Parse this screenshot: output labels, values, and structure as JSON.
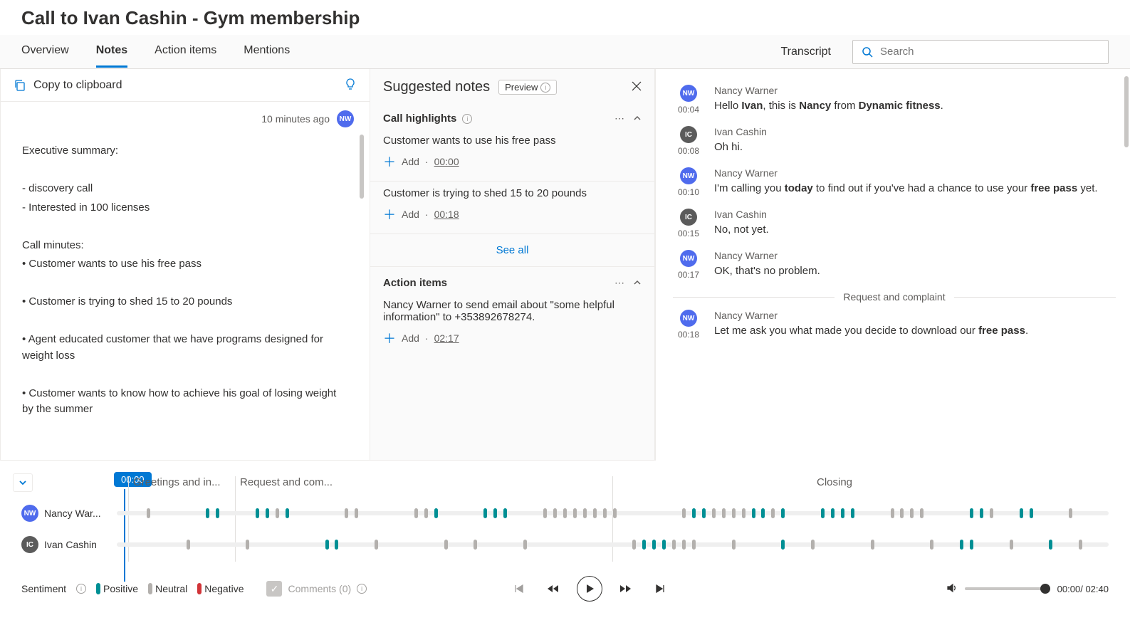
{
  "page_title": "Call to Ivan Cashin - Gym membership",
  "tabs": {
    "overview": "Overview",
    "notes": "Notes",
    "action_items": "Action items",
    "mentions": "Mentions"
  },
  "transcript_label": "Transcript",
  "search_placeholder": "Search",
  "copy_label": "Copy to clipboard",
  "notes_meta_time": "10 minutes ago",
  "notes_meta_initials": "NW",
  "notes_body": {
    "l1": "Executive summary:",
    "l2": "- discovery call",
    "l3": "- Interested in 100 licenses",
    "l4": "Call minutes:",
    "l5": "• Customer wants to use his free pass",
    "l6": "• Customer is trying to shed 15 to 20 pounds",
    "l7": "• Agent educated customer that we have programs designed for weight loss",
    "l8": "• Customer wants to know how to achieve his goal of losing weight by the summer"
  },
  "sugg": {
    "title": "Suggested notes",
    "preview": "Preview",
    "highlights": "Call highlights",
    "h1": "Customer wants to use his free pass",
    "h1_ts": "00:00",
    "h2": "Customer is trying to shed 15 to 20 pounds",
    "h2_ts": "00:18",
    "add": "Add",
    "see_all": "See all",
    "actions_title": "Action items",
    "a1": "Nancy Warner to send email about \"some helpful information\" to +353892678274.",
    "a1_ts": "02:17"
  },
  "transcript": {
    "nw": "Nancy Warner",
    "ic": "Ivan Cashin",
    "t1_time": "00:04",
    "t2_time": "00:08",
    "t3_time": "00:10",
    "t4_time": "00:15",
    "t5_time": "00:17",
    "t6_time": "00:18",
    "t2_msg": "Oh hi.",
    "t4_msg": "No, not yet.",
    "t5_msg": "OK, that's no problem.",
    "divider": "Request and complaint"
  },
  "timeline": {
    "playhead": "00:00",
    "seg1": "Greetings and in...",
    "seg2": "Request and com...",
    "seg3": "Closing",
    "speaker1": "Nancy War...",
    "speaker2": "Ivan Cashin"
  },
  "footer": {
    "sentiment": "Sentiment",
    "positive": "Positive",
    "neutral": "Neutral",
    "negative": "Negative",
    "comments": "Comments (0)",
    "cur": "00:00",
    "total": "/ 02:40"
  }
}
